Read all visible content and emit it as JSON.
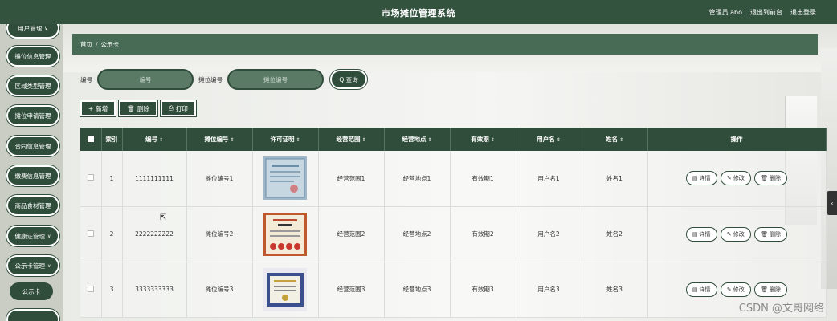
{
  "header": {
    "title": "市场摊位管理系统",
    "admin": "管理员 abo",
    "goto_front": "退出到前台",
    "logout": "退出登录"
  },
  "sidebar": {
    "items": [
      {
        "label": "用户管理",
        "chevron": true
      },
      {
        "label": "摊位信息管理",
        "chevron": false
      },
      {
        "label": "区域类型管理",
        "chevron": false
      },
      {
        "label": "摊位申请管理",
        "chevron": false
      },
      {
        "label": "合同信息管理",
        "chevron": false
      },
      {
        "label": "缴费信息管理",
        "chevron": false
      },
      {
        "label": "商品食材管理",
        "chevron": false
      },
      {
        "label": "健康证管理",
        "chevron": true
      },
      {
        "label": "公示卡管理",
        "chevron": true
      }
    ],
    "sub_item": "公示卡"
  },
  "breadcrumb": {
    "home": "首页",
    "separator": "/",
    "current": "公示卡"
  },
  "search": {
    "field1_label": "编号",
    "field1_placeholder": "编号",
    "field2_label": "摊位编号",
    "field2_placeholder": "摊位编号",
    "query_label": "查询"
  },
  "actions": {
    "add": "新增",
    "delete": "删除",
    "print": "打印"
  },
  "table": {
    "headers": [
      "索引",
      "编号",
      "摊位编号",
      "许可证明",
      "经营范围",
      "经营地点",
      "有效期",
      "用户名",
      "姓名",
      "操作"
    ],
    "rows": [
      {
        "index": "1",
        "code": "1111111111",
        "stall": "摊位编号1",
        "scope": "经营范围1",
        "place": "经营地点1",
        "valid": "有效期1",
        "user": "用户名1",
        "name": "姓名1"
      },
      {
        "index": "2",
        "code": "2222222222",
        "stall": "摊位编号2",
        "scope": "经营范围2",
        "place": "经营地点2",
        "valid": "有效期2",
        "user": "用户名2",
        "name": "姓名2"
      },
      {
        "index": "3",
        "code": "3333333333",
        "stall": "摊位编号3",
        "scope": "经营范围3",
        "place": "经营地点3",
        "valid": "有效期3",
        "user": "用户名3",
        "name": "姓名3"
      }
    ],
    "ops": {
      "detail": "详情",
      "edit": "修改",
      "delete": "删除"
    }
  },
  "watermark": "CSDN @文哥网络",
  "colors": {
    "primary": "#2f4d3a",
    "breadcrumb": "#486b55",
    "topbar": "#33533f"
  }
}
